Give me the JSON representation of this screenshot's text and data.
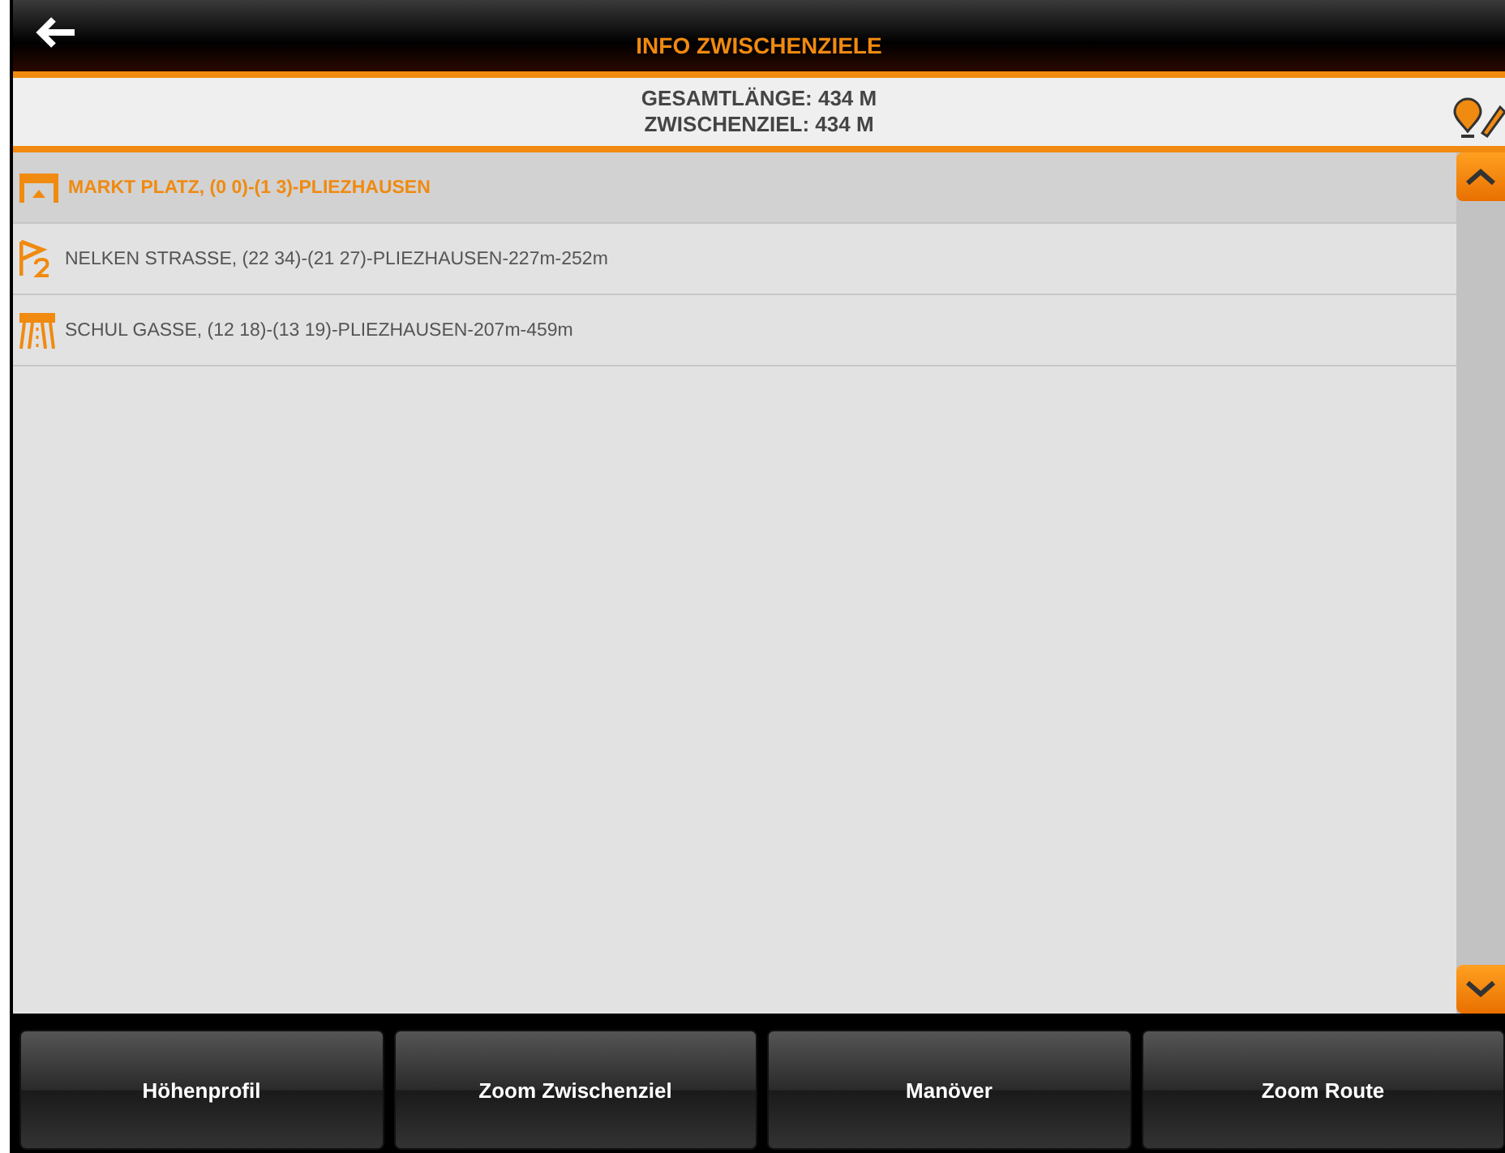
{
  "header": {
    "title": "INFO ZWISCHENZIELE"
  },
  "summary": {
    "lines": [
      "GESAMTLÄNGE: 434 M",
      "ZWISCHENZIEL: 434 M"
    ]
  },
  "waypoints": [
    {
      "kind": "start",
      "label": "MARKT PLATZ, (0 0)-(1 3)-PLIEZHAUSEN",
      "selected": true
    },
    {
      "kind": "waypoint",
      "label": "NELKEN STRASSE, (22 34)-(21 27)-PLIEZHAUSEN-227m-252m",
      "selected": false
    },
    {
      "kind": "destination",
      "label": "SCHUL GASSE, (12 18)-(13 19)-PLIEZHAUSEN-207m-459m",
      "selected": false
    }
  ],
  "buttons": [
    "Höhenprofil",
    "Zoom Zwischenziel",
    "Manöver",
    "Zoom Route"
  ]
}
